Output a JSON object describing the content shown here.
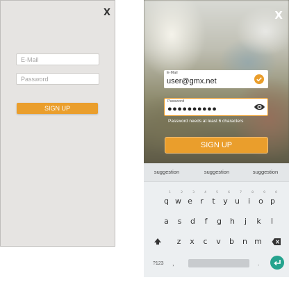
{
  "left_screen": {
    "close_label": "X",
    "email_placeholder": "E-Mail",
    "password_placeholder": "Password",
    "signup_label": "SIGN UP"
  },
  "phone": {
    "close_label": "X",
    "email": {
      "label": "E-Mail",
      "value": "user@gmx.net"
    },
    "password": {
      "label": "Password",
      "masked_value": "●●●●●●●●●●"
    },
    "password_hint": "Password needs at least 6 characters",
    "signup_label": "SIGN UP",
    "accent_color": "#ea9e2c",
    "check_color": "#ea9e2c"
  },
  "keyboard": {
    "suggestions": [
      "suggestion",
      "suggestion",
      "suggestion"
    ],
    "row1": [
      {
        "char": "q",
        "hint": "1"
      },
      {
        "char": "w",
        "hint": "2"
      },
      {
        "char": "e",
        "hint": "3"
      },
      {
        "char": "r",
        "hint": "4"
      },
      {
        "char": "t",
        "hint": "5"
      },
      {
        "char": "y",
        "hint": "6"
      },
      {
        "char": "u",
        "hint": "7"
      },
      {
        "char": "i",
        "hint": "8"
      },
      {
        "char": "o",
        "hint": "9"
      },
      {
        "char": "p",
        "hint": "0"
      }
    ],
    "row2": [
      "a",
      "s",
      "d",
      "f",
      "g",
      "h",
      "j",
      "k",
      "l"
    ],
    "row3": [
      "z",
      "x",
      "c",
      "v",
      "b",
      "n",
      "m"
    ],
    "symbols_label": "?123",
    "comma_label": ",",
    "period_label": ".",
    "enter_color": "#25a38e"
  }
}
